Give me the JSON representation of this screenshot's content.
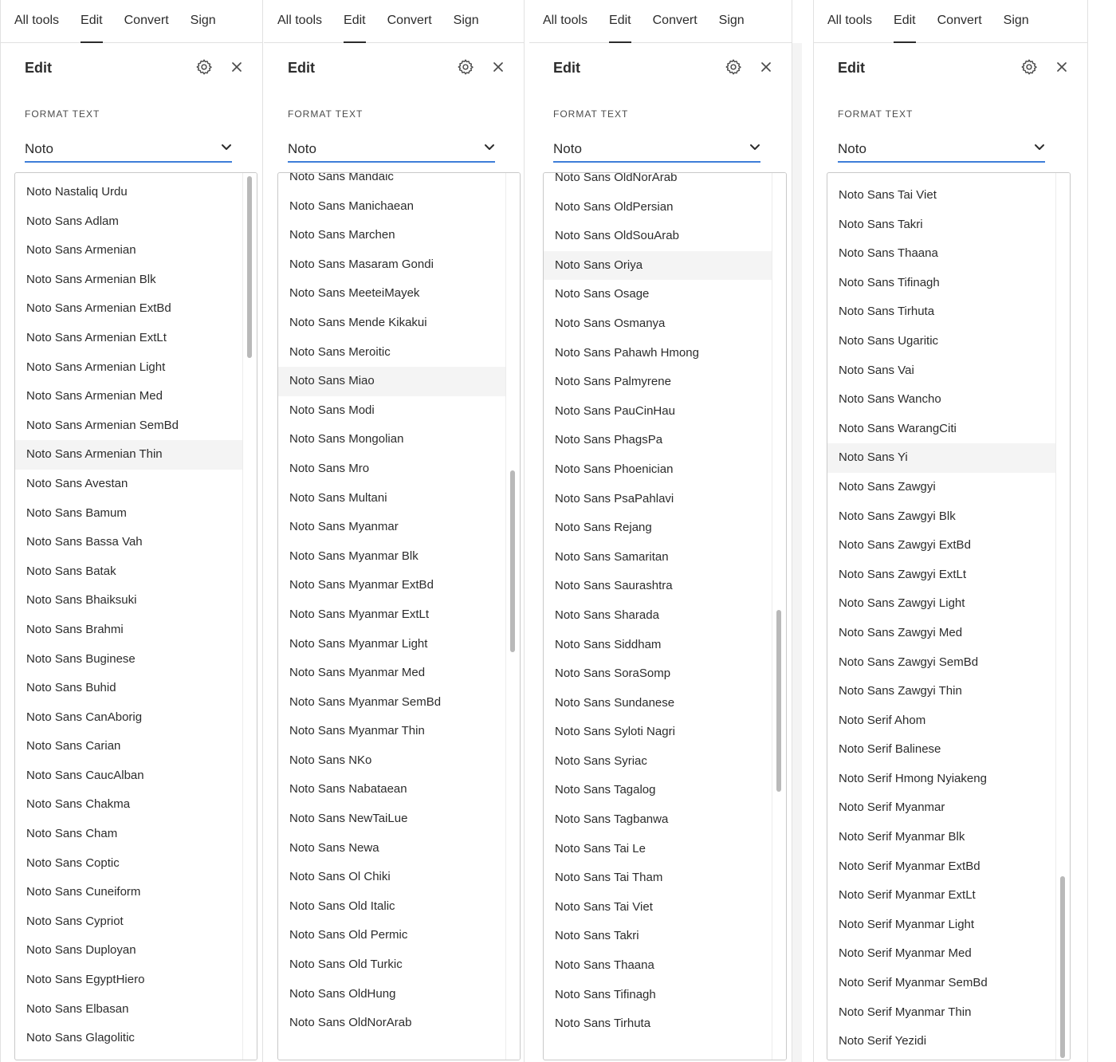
{
  "nav": {
    "all_tools": "All tools",
    "edit": "Edit",
    "convert": "Convert",
    "sign": "Sign"
  },
  "panel": {
    "title": "Edit",
    "section_label": "FORMAT TEXT",
    "gear_icon": "gear-icon",
    "close_icon": "close-icon"
  },
  "panels": [
    {
      "font_value": "Noto",
      "hovered_item": "Noto Sans Armenian Thin",
      "scroll_position": 0.0,
      "items": [
        "Noto Nastaliq Urdu",
        "Noto Sans Adlam",
        "Noto Sans Armenian",
        "Noto Sans Armenian Blk",
        "Noto Sans Armenian ExtBd",
        "Noto Sans Armenian ExtLt",
        "Noto Sans Armenian Light",
        "Noto Sans Armenian Med",
        "Noto Sans Armenian SemBd",
        "Noto Sans Armenian Thin",
        "Noto Sans Avestan",
        "Noto Sans Bamum",
        "Noto Sans Bassa Vah",
        "Noto Sans Batak",
        "Noto Sans Bhaiksuki",
        "Noto Sans Brahmi",
        "Noto Sans Buginese",
        "Noto Sans Buhid",
        "Noto Sans CanAborig",
        "Noto Sans Carian",
        "Noto Sans CaucAlban",
        "Noto Sans Chakma",
        "Noto Sans Cham",
        "Noto Sans Coptic",
        "Noto Sans Cuneiform",
        "Noto Sans Cypriot",
        "Noto Sans Duployan",
        "Noto Sans EgyptHiero",
        "Noto Sans Elbasan",
        "Noto Sans Glagolitic"
      ]
    },
    {
      "font_value": "Noto",
      "hovered_item": "Noto Sans Miao",
      "scroll_position": 0.42,
      "items": [
        "Noto Sans Mandaic",
        "Noto Sans Manichaean",
        "Noto Sans Marchen",
        "Noto Sans Masaram Gondi",
        "Noto Sans MeeteiMayek",
        "Noto Sans Mende Kikakui",
        "Noto Sans Meroitic",
        "Noto Sans Miao",
        "Noto Sans Modi",
        "Noto Sans Mongolian",
        "Noto Sans Mro",
        "Noto Sans Multani",
        "Noto Sans Myanmar",
        "Noto Sans Myanmar Blk",
        "Noto Sans Myanmar ExtBd",
        "Noto Sans Myanmar ExtLt",
        "Noto Sans Myanmar Light",
        "Noto Sans Myanmar Med",
        "Noto Sans Myanmar SemBd",
        "Noto Sans Myanmar Thin",
        "Noto Sans NKo",
        "Noto Sans Nabataean",
        "Noto Sans NewTaiLue",
        "Noto Sans Newa",
        "Noto Sans Ol Chiki",
        "Noto Sans Old Italic",
        "Noto Sans Old Permic",
        "Noto Sans Old Turkic",
        "Noto Sans OldHung",
        "Noto Sans OldNorArab"
      ]
    },
    {
      "font_value": "Noto",
      "hovered_item": "Noto Sans Oriya",
      "scroll_position": 0.62,
      "items": [
        "Noto Sans OldNorArab",
        "Noto Sans OldPersian",
        "Noto Sans OldSouArab",
        "Noto Sans Oriya",
        "Noto Sans Osage",
        "Noto Sans Osmanya",
        "Noto Sans Pahawh Hmong",
        "Noto Sans Palmyrene",
        "Noto Sans PauCinHau",
        "Noto Sans PhagsPa",
        "Noto Sans Phoenician",
        "Noto Sans PsaPahlavi",
        "Noto Sans Rejang",
        "Noto Sans Samaritan",
        "Noto Sans Saurashtra",
        "Noto Sans Sharada",
        "Noto Sans Siddham",
        "Noto Sans SoraSomp",
        "Noto Sans Sundanese",
        "Noto Sans Syloti Nagri",
        "Noto Sans Syriac",
        "Noto Sans Tagalog",
        "Noto Sans Tagbanwa",
        "Noto Sans Tai Le",
        "Noto Sans Tai Tham",
        "Noto Sans Tai Viet",
        "Noto Sans Takri",
        "Noto Sans Thaana",
        "Noto Sans Tifinagh",
        "Noto Sans Tirhuta"
      ]
    },
    {
      "font_value": "Noto",
      "hovered_item": "Noto Sans Yi",
      "scroll_position": 1.0,
      "items": [
        "Noto Sans Tai Viet",
        "Noto Sans Takri",
        "Noto Sans Thaana",
        "Noto Sans Tifinagh",
        "Noto Sans Tirhuta",
        "Noto Sans Ugaritic",
        "Noto Sans Vai",
        "Noto Sans Wancho",
        "Noto Sans WarangCiti",
        "Noto Sans Yi",
        "Noto Sans Zawgyi",
        "Noto Sans Zawgyi Blk",
        "Noto Sans Zawgyi ExtBd",
        "Noto Sans Zawgyi ExtLt",
        "Noto Sans Zawgyi Light",
        "Noto Sans Zawgyi Med",
        "Noto Sans Zawgyi SemBd",
        "Noto Sans Zawgyi Thin",
        "Noto Serif Ahom",
        "Noto Serif Balinese",
        "Noto Serif Hmong Nyiakeng",
        "Noto Serif Myanmar",
        "Noto Serif Myanmar Blk",
        "Noto Serif Myanmar ExtBd",
        "Noto Serif Myanmar ExtLt",
        "Noto Serif Myanmar Light",
        "Noto Serif Myanmar Med",
        "Noto Serif Myanmar SemBd",
        "Noto Serif Myanmar Thin",
        "Noto Serif Yezidi"
      ]
    }
  ],
  "colors": {
    "accent": "#3e7ed8",
    "hover_bg": "#f4f4f4",
    "text": "#2c2c2c",
    "border": "#e1e1e1"
  }
}
